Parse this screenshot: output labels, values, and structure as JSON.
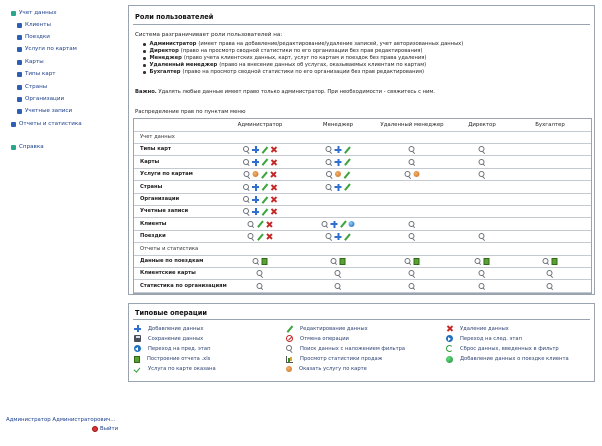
{
  "sidebar": {
    "items": [
      {
        "label": "Учет данных",
        "color": "#2ca58d"
      },
      {
        "label": "Клиенты",
        "color": "#2d5fb4"
      },
      {
        "label": "Поездки",
        "color": "#2d5fb4"
      },
      {
        "label": "Услуги по картам",
        "color": "#2d5fb4"
      },
      {
        "label": "Карты",
        "color": "#2d5fb4"
      },
      {
        "label": "Типы карт",
        "color": "#2d5fb4"
      },
      {
        "label": "Страны",
        "color": "#2d5fb4"
      },
      {
        "label": "Организации",
        "color": "#2d5fb4"
      },
      {
        "label": "Учетные записи",
        "color": "#2d5fb4"
      },
      {
        "label": "Отчеты и статистика",
        "color": "#2d5fb4"
      },
      {
        "label": "Справка",
        "color": "#2ca58d"
      }
    ],
    "user_name": "Администратор Администраторович",
    "logout_label": "Выйти"
  },
  "roles": {
    "title": "Роли пользователей",
    "intro": "Система разграничивает роли пользователей на:",
    "list": [
      {
        "name": "Администратор",
        "desc": "(имеет права на добавление/редактирование/удаление записей, учет авторизованных данных)"
      },
      {
        "name": "Директор",
        "desc": "(право на просмотр сводной статистики по его организации без прав редактирования)"
      },
      {
        "name": "Менеджер",
        "desc": "(право учета клиентских данных, карт, услуг по картам и поездок без права удаления)"
      },
      {
        "name": "Удаленный менеджер",
        "desc": "(право на внесение данных об услугах, оказываемых клиентам по картам)"
      },
      {
        "name": "Бухгалтер",
        "desc": "(право на просмотр сводной статистики по его организации без прав редактирования)"
      }
    ],
    "important_label": "Важно.",
    "important_text": "Удалять любые данные имеет право только администратор. При необходимости - свяжитесь с ним.",
    "distribution_title": "Распределение прав по пунктам меню"
  },
  "table": {
    "columns": [
      "Администратор",
      "Менеджер",
      "Удаленный менеджер",
      "Директор",
      "Бухгалтер"
    ],
    "rows": [
      {
        "label": "Учет данных",
        "group": true,
        "cells": [
          [],
          [],
          [],
          [],
          []
        ]
      },
      {
        "label": "Типы карт",
        "cells": [
          [
            "search",
            "plus",
            "edit",
            "delete"
          ],
          [
            "search",
            "plus",
            "edit"
          ],
          [
            "search"
          ],
          [
            "search"
          ],
          []
        ]
      },
      {
        "label": "Карты",
        "cells": [
          [
            "search",
            "plus",
            "edit",
            "delete"
          ],
          [
            "search",
            "plus",
            "edit"
          ],
          [
            "search"
          ],
          [
            "search"
          ],
          []
        ]
      },
      {
        "label": "Услуги по картам",
        "cells": [
          [
            "search",
            "order",
            "edit",
            "delete"
          ],
          [
            "search",
            "order",
            "edit"
          ],
          [
            "search",
            "order"
          ],
          [
            "search"
          ],
          []
        ]
      },
      {
        "label": "Страны",
        "cells": [
          [
            "search",
            "plus",
            "edit",
            "delete"
          ],
          [
            "search",
            "plus",
            "edit"
          ],
          [],
          [],
          []
        ]
      },
      {
        "label": "Организации",
        "cells": [
          [
            "search",
            "plus",
            "edit",
            "delete"
          ],
          [],
          [],
          [],
          []
        ]
      },
      {
        "label": "Учетные записи",
        "cells": [
          [
            "search",
            "plus",
            "edit",
            "delete"
          ],
          [],
          [],
          [],
          []
        ]
      },
      {
        "label": "Клиенты",
        "cells": [
          [
            "search",
            "edit",
            "delete"
          ],
          [
            "search",
            "plus",
            "edit",
            "globe"
          ],
          [
            "search"
          ],
          [],
          []
        ]
      },
      {
        "label": "Поездки",
        "cells": [
          [
            "search",
            "edit",
            "delete"
          ],
          [
            "search",
            "plus",
            "edit"
          ],
          [
            "search"
          ],
          [
            "search"
          ],
          []
        ]
      },
      {
        "label": "Отчеты и статистика",
        "group": true,
        "cells": [
          [],
          [],
          [],
          [],
          []
        ]
      },
      {
        "label": "Данные по поездкам",
        "cells": [
          [
            "search",
            "excel"
          ],
          [
            "search",
            "excel"
          ],
          [
            "search",
            "excel"
          ],
          [
            "search",
            "excel"
          ],
          [
            "search",
            "excel"
          ]
        ]
      },
      {
        "label": "Клиентские карты",
        "cells": [
          [
            "search"
          ],
          [
            "search"
          ],
          [
            "search"
          ],
          [
            "search"
          ],
          [
            "search"
          ]
        ]
      },
      {
        "label": "Статистика по организациям",
        "cells": [
          [
            "search"
          ],
          [
            "search"
          ],
          [
            "search"
          ],
          [
            "search"
          ],
          [
            "search"
          ]
        ]
      }
    ]
  },
  "operations": {
    "title": "Типовые операции",
    "items": [
      {
        "icon": "plus",
        "label": "Добавление данных"
      },
      {
        "icon": "edit",
        "label": "Редактирование данных"
      },
      {
        "icon": "delete",
        "label": "Удаление данных"
      },
      {
        "icon": "save",
        "label": "Сохранение данных"
      },
      {
        "icon": "cancel",
        "label": "Отмена операции"
      },
      {
        "icon": "next",
        "label": "Переход на след. этап"
      },
      {
        "icon": "prev",
        "label": "Переход на пред. этап"
      },
      {
        "icon": "search",
        "label": "Поиск данных с наложением фильтра"
      },
      {
        "icon": "reset",
        "label": "Сброс данных, введенных в фильтр"
      },
      {
        "icon": "excel",
        "label": "Построение отчета .xls"
      },
      {
        "icon": "chart",
        "label": "Просмотр статистики продаж"
      },
      {
        "icon": "addcl",
        "label": "Добавление данных о поездке клиента"
      },
      {
        "icon": "check",
        "label": "Услуга по карте оказана"
      },
      {
        "icon": "order",
        "label": "Оказать услугу по карте"
      }
    ]
  }
}
